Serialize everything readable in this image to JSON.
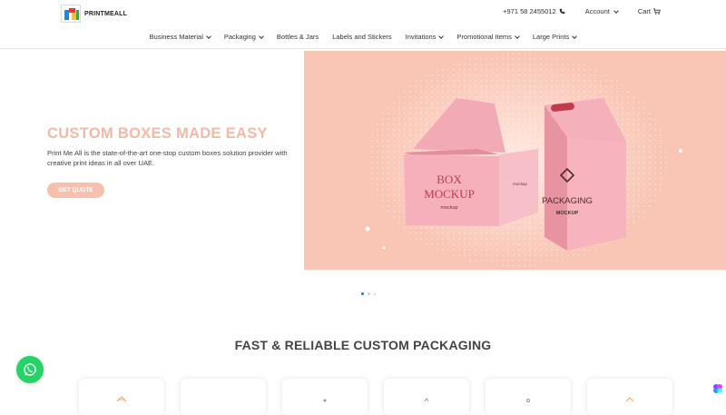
{
  "header": {
    "brand": "PRINTMEALL",
    "phone": "+971 58 2455012",
    "account_label": "Account",
    "cart_label": "Cart"
  },
  "nav": {
    "items": [
      {
        "label": "Business Material",
        "dropdown": true
      },
      {
        "label": "Packaging",
        "dropdown": true
      },
      {
        "label": "Bottles & Jars",
        "dropdown": false
      },
      {
        "label": "Labels and Stickers",
        "dropdown": false
      },
      {
        "label": "Invitations",
        "dropdown": true
      },
      {
        "label": "Promotional Items",
        "dropdown": true
      },
      {
        "label": "Large Prints",
        "dropdown": true
      }
    ]
  },
  "hero": {
    "title": "CUSTOM BOXES MADE EASY",
    "description": "Print Me All is the state-of-the-art one-stop custom boxes solution provider with creative print ideas in all over UAE.",
    "cta_label": "GET QUOTE",
    "image": {
      "box_text_line1": "BOX",
      "box_text_line2": "MOCKUP",
      "box_brand": "mockup",
      "box_side_text": "mockup",
      "bag_text_line1": "PACKAGING",
      "bag_text_line2": "MOCKUP"
    }
  },
  "carousel": {
    "slides": 3,
    "active": 0
  },
  "section": {
    "title": "FAST & RELIABLE CUSTOM PACKAGING"
  },
  "colors": {
    "accent": "#f5b8a3",
    "hero_bg": "#f9c5b4",
    "whatsapp": "#25d366",
    "dot_active": "#1a73e8"
  },
  "icons": [
    "phone-icon",
    "cart-icon",
    "whatsapp-icon",
    "chevron-down-icon"
  ]
}
